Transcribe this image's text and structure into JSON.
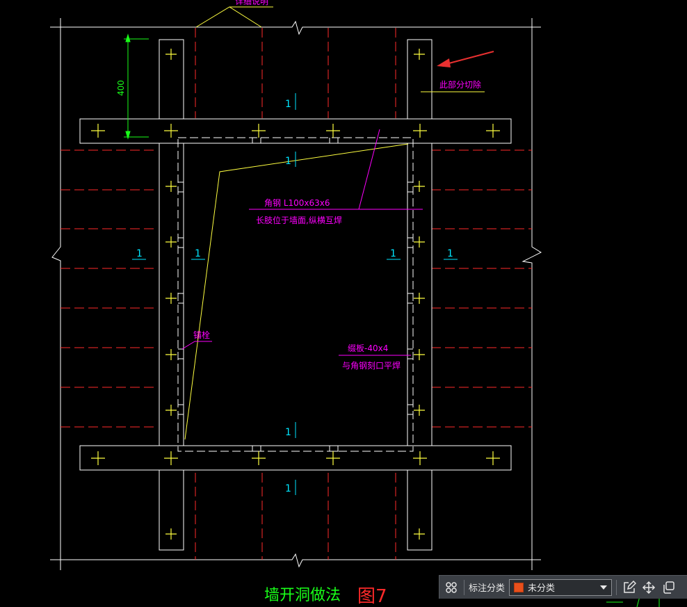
{
  "drawing": {
    "top_label": "详细说明",
    "dimension": "400",
    "section_mark": "1",
    "cut_note": "此部分切除",
    "angle_steel_line1": "角钢 L100x63x6",
    "angle_steel_line2": "长肢位于墙面,纵横互焊",
    "bolt_note": "锚栓",
    "flat_steel_line1": "缀板-40x4",
    "flat_steel_line2": "与角钢刻口平焊",
    "title": "墙开洞做法",
    "figure_no": "图7"
  },
  "toolbar": {
    "classify_label": "标注分类",
    "category_value": "未分类",
    "category_color": "#e8501c",
    "icons": [
      "grid-icon",
      "edit-icon",
      "move-icon",
      "copy-icon"
    ]
  },
  "colors": {
    "white": "#ffffff",
    "red_dash": "#ff2a2a",
    "magenta": "#ff00ff",
    "yellow": "#ffff40",
    "green": "#19ff19",
    "cyan": "#00e5ff",
    "arrow_red": "#e83030"
  }
}
